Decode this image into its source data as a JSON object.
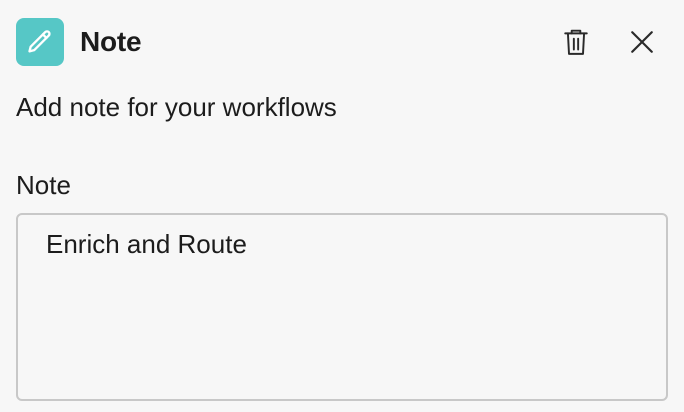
{
  "header": {
    "title": "Note",
    "icon": "pencil-icon",
    "icon_bg": "#56c7c6",
    "actions": [
      "trash-icon",
      "close-icon"
    ]
  },
  "description": "Add note for your workflows",
  "form": {
    "note_label": "Note",
    "note_value": "Enrich and Route"
  }
}
